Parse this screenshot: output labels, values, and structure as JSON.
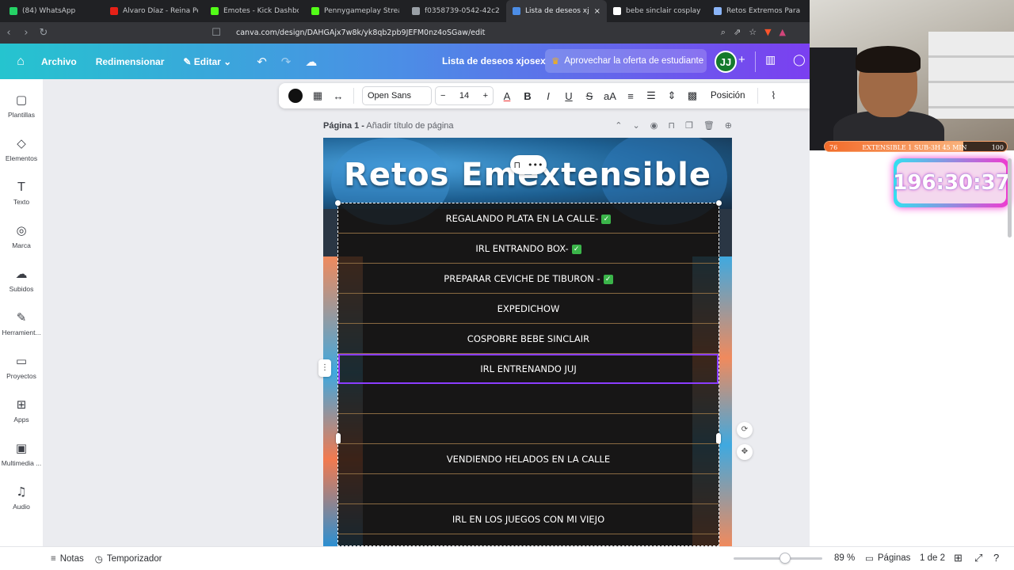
{
  "browser": {
    "tabs": [
      {
        "label": "(84) WhatsApp",
        "icon": "whatsapp-icon",
        "color": "#25d366"
      },
      {
        "label": "Álvaro Díaz - Reina Pepiad",
        "icon": "youtube-icon",
        "color": "#e62117"
      },
      {
        "label": "Emotes - Kick Dashboard",
        "icon": "kick-icon",
        "color": "#53fc18"
      },
      {
        "label": "Pennygameplay Stream - V",
        "icon": "kick-icon",
        "color": "#53fc18"
      },
      {
        "label": "f0358739-0542-42c2-b7d",
        "icon": "github-icon",
        "color": "#9aa0a6"
      },
      {
        "label": "Lista de deseos xjosex",
        "icon": "canva-icon",
        "color": "#4c8de6",
        "active": true
      },
      {
        "label": "bebe sinclair cosplay - Bus",
        "icon": "google-icon",
        "color": "#ffffff"
      },
      {
        "label": "Retos Extremos Para Strea",
        "icon": "gemini-icon",
        "color": "#8ab4f8"
      }
    ],
    "url": "canva.com/design/DAHGAjx7w8k/yk8qb2pb9JEFM0nz4oSGaw/edit"
  },
  "topbar": {
    "archivo": "Archivo",
    "redimensionar": "Redimensionar",
    "editar": "Editar",
    "doc_title": "Lista de deseos xjosex",
    "promo": "Aprovechar la oferta de estudiante",
    "avatar": "JJ"
  },
  "sidebar": {
    "items": [
      {
        "label": "Plantillas",
        "icon": "templates-icon",
        "glyph": "▢"
      },
      {
        "label": "Elementos",
        "icon": "elements-icon",
        "glyph": "◇"
      },
      {
        "label": "Texto",
        "icon": "text-icon",
        "glyph": "T"
      },
      {
        "label": "Marca",
        "icon": "brand-icon",
        "glyph": "◎"
      },
      {
        "label": "Subidos",
        "icon": "upload-icon",
        "glyph": "☁"
      },
      {
        "label": "Herramient...",
        "icon": "tools-icon",
        "glyph": "✎"
      },
      {
        "label": "Proyectos",
        "icon": "folder-icon",
        "glyph": "▭"
      },
      {
        "label": "Apps",
        "icon": "apps-icon",
        "glyph": "⊞"
      },
      {
        "label": "Multimedia ...",
        "icon": "media-icon",
        "glyph": "▣"
      },
      {
        "label": "Audio",
        "icon": "audio-icon",
        "glyph": "♫"
      }
    ]
  },
  "toolbar": {
    "font": "Open Sans",
    "size": "14",
    "position": "Posición"
  },
  "page": {
    "label": "Página 1 -",
    "title_placeholder": "Añadir título de página"
  },
  "design": {
    "title": "Retos Emextensible",
    "rows": [
      {
        "text": "REGALANDO PLATA EN LA CALLE-",
        "done": true
      },
      {
        "text": "IRL ENTRANDO BOX-",
        "done": true
      },
      {
        "text": "PREPARAR CEVICHE DE TIBURON -",
        "done": true
      },
      {
        "text": "EXPEDICHOW",
        "done": false
      },
      {
        "text": "COSPOBRE BEBE SINCLAIR",
        "done": false
      },
      {
        "text": "IRL ENTRENANDO JUJ",
        "done": false,
        "selected": true
      },
      {
        "text": "",
        "done": false
      },
      {
        "text": "",
        "done": false
      },
      {
        "text": "VENDIENDO HELADOS EN LA CALLE",
        "done": false
      },
      {
        "text": "",
        "done": false
      },
      {
        "text": "IRL EN LOS JUEGOS CON MI VIEJO",
        "done": false
      },
      {
        "text": "...",
        "done": false
      }
    ]
  },
  "bottombar": {
    "notas": "Notas",
    "temporizador": "Temporizador",
    "zoom": "89 %",
    "zoom_level": 0.89,
    "paginas": "Páginas",
    "page_count": "1 de 2"
  },
  "overlay": {
    "progress_left": "76",
    "progress_text": "EXTENSIBLE 1 SUB-3H 45 MIN",
    "progress_right": "100",
    "progress_fraction": 0.76,
    "timer": "196:30:37"
  }
}
